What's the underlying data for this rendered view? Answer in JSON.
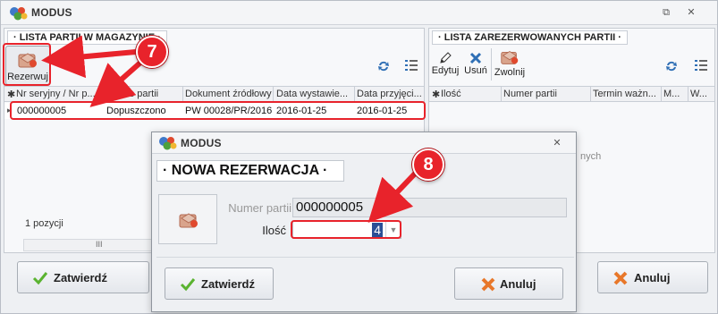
{
  "app_title": "MODUS",
  "left_panel": {
    "header": "· LISTA PARTII W MAGAZYNIE ·",
    "reserve_button": "Rezerwuj",
    "columns": [
      "Nr seryjny / Nr p...",
      "Status partii",
      "Dokument źródłowy",
      "Data wystawie...",
      "Data przyjęci..."
    ],
    "rows": [
      {
        "serial": "000000005",
        "status": "Dopuszczono",
        "document": "PW 00028/PR/2016",
        "issue_date": "2016-01-25",
        "receipt_date": "2016-01-25"
      }
    ],
    "footer_count": "1 pozycji",
    "scroll_marker": "III",
    "confirm_button": "Zatwierdź"
  },
  "right_panel": {
    "header": "· LISTA ZAREZERWOWANYCH PARTII ·",
    "edit_button": "Edytuj",
    "delete_button": "Usuń",
    "release_button": "Zwolnij",
    "columns": [
      "Ilość",
      "Numer partii",
      "Termin ważn...",
      "M...",
      "W..."
    ],
    "empty_text_fragment": "nych",
    "cancel_button": "Anuluj"
  },
  "dialog": {
    "title": "MODUS",
    "header": "· NOWA REZERWACJA ·",
    "batch_label": "Numer partii",
    "batch_value": "000000005",
    "qty_label": "Ilość",
    "qty_value": "4",
    "confirm_button": "Zatwierdź",
    "cancel_button": "Anuluj"
  },
  "annotations": {
    "step_a": "7",
    "step_b": "8"
  },
  "colors": {
    "highlight": "#e8232b",
    "confirm_icon": "#5ab330",
    "cancel_icon": "#e8772a",
    "refresh_icon": "#2f6fb5"
  }
}
